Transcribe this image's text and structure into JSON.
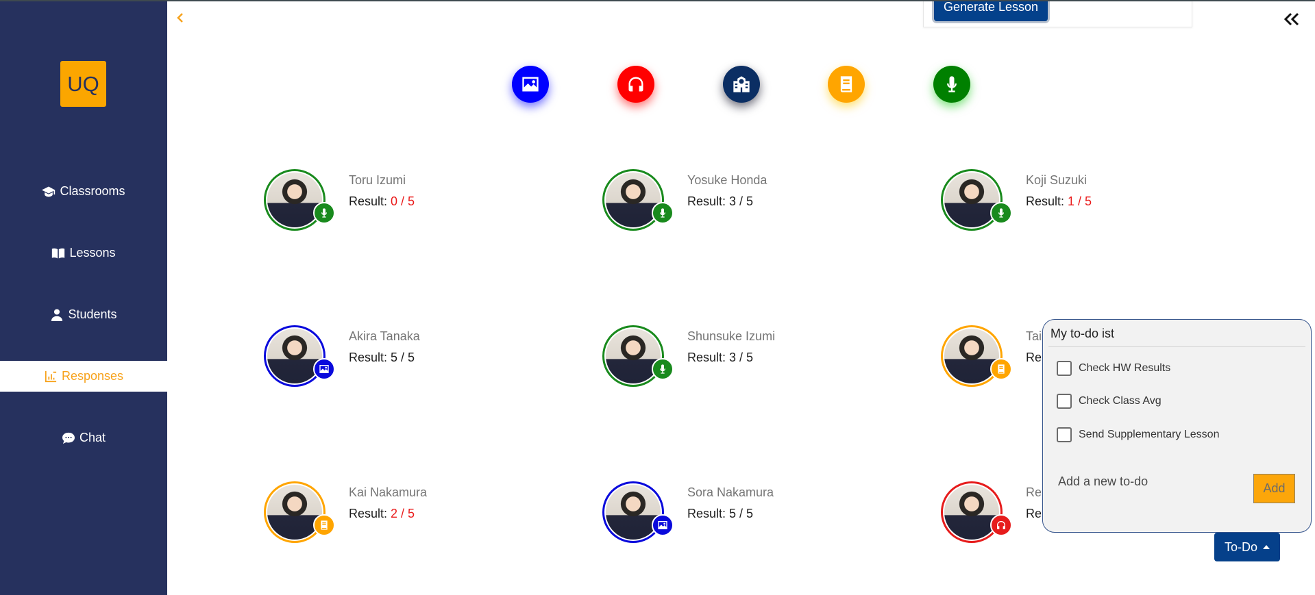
{
  "sidebar": {
    "logo_text": "UQ",
    "items": [
      {
        "label": "Classrooms",
        "icon": "graduation-cap-icon"
      },
      {
        "label": "Lessons",
        "icon": "book-open-icon"
      },
      {
        "label": "Students",
        "icon": "user-icon"
      },
      {
        "label": "Responses",
        "icon": "chart-icon",
        "active": true
      },
      {
        "label": "Chat",
        "icon": "speech-bubble-icon"
      }
    ],
    "colors": {
      "background": "#26315e",
      "active_text": "#f7a21b",
      "logo_bg": "#fba600"
    }
  },
  "header": {
    "generate_label": "Generate Lesson"
  },
  "filters": [
    {
      "icon": "image-icon",
      "color": "#0000ff"
    },
    {
      "icon": "headphones-icon",
      "color": "#ff0000"
    },
    {
      "icon": "school-icon",
      "color": "#0b2e63"
    },
    {
      "icon": "book-icon",
      "color": "#ffa500"
    },
    {
      "icon": "microphone-icon",
      "color": "#008000"
    }
  ],
  "students": [
    {
      "name": "Toru Izumi",
      "result_label": "Result:",
      "score": "0 / 5",
      "low": true,
      "type": "microphone-icon",
      "color": "#198a1d"
    },
    {
      "name": "Yosuke Honda",
      "result_label": "Result:",
      "score": "3 / 5",
      "low": false,
      "type": "microphone-icon",
      "color": "#198a1d"
    },
    {
      "name": "Koji Suzuki",
      "result_label": "Result:",
      "score": "1 / 5",
      "low": true,
      "type": "microphone-icon",
      "color": "#198a1d"
    },
    {
      "name": "Akira Tanaka",
      "result_label": "Result:",
      "score": "5 / 5",
      "low": false,
      "type": "image-icon",
      "color": "#0a0adc"
    },
    {
      "name": "Shunsuke Izumi",
      "result_label": "Result:",
      "score": "3 / 5",
      "low": false,
      "type": "microphone-icon",
      "color": "#198a1d"
    },
    {
      "name": "Tai",
      "result_label": "Re",
      "score": "",
      "low": false,
      "type": "book-icon",
      "color": "#ffa500"
    },
    {
      "name": "Kai Nakamura",
      "result_label": "Result:",
      "score": "2 / 5",
      "low": true,
      "type": "book-icon",
      "color": "#ffa500"
    },
    {
      "name": "Sora Nakamura",
      "result_label": "Result:",
      "score": "5 / 5",
      "low": false,
      "type": "image-icon",
      "color": "#0a0adc"
    },
    {
      "name": "Re",
      "result_label": "Re",
      "score": "",
      "low": false,
      "type": "headphones-icon",
      "color": "#e61c1c"
    }
  ],
  "todo": {
    "title": "My to-do ist",
    "items": [
      "Check HW Results",
      "Check Class Avg",
      "Send Supplementary Lesson"
    ],
    "input_placeholder": "Add a new to-do",
    "add_label": "Add",
    "toggle_label": "To-Do"
  }
}
